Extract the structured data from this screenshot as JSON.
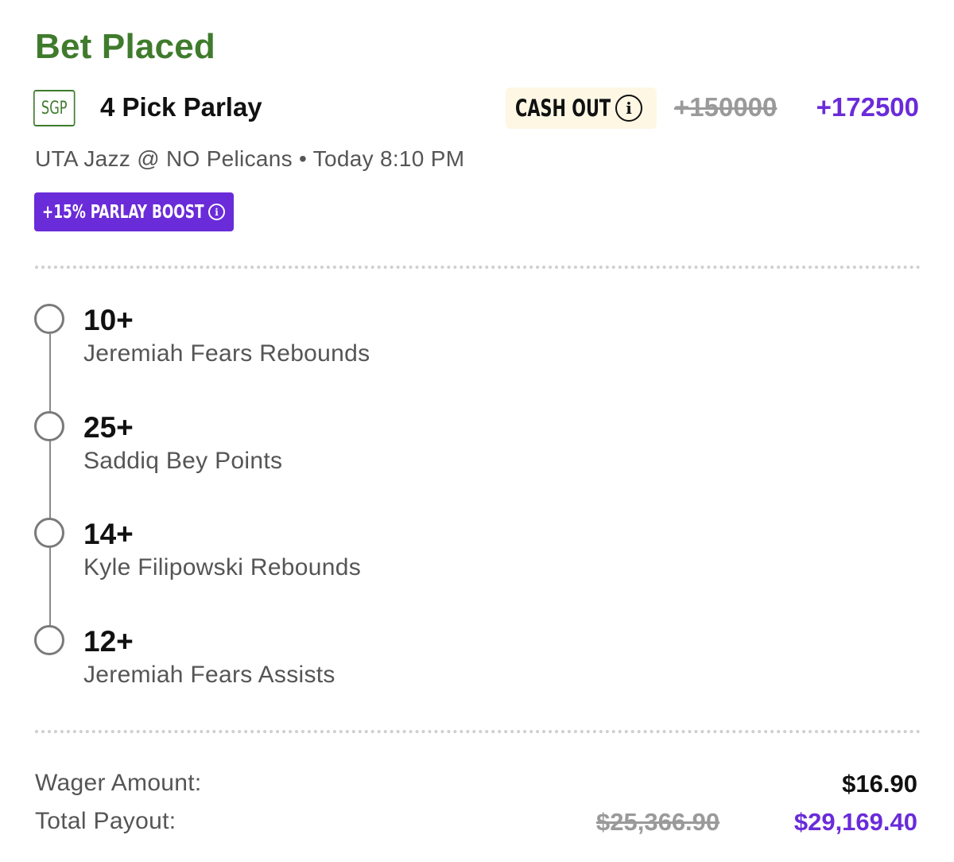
{
  "status": {
    "title": "Bet Placed"
  },
  "header": {
    "badge": "SGP",
    "title": "4 Pick Parlay",
    "cash_out_label": "CASH OUT",
    "info_glyph": "i",
    "original_odds": "+150000",
    "boosted_odds": "+172500"
  },
  "game": {
    "info": "UTA Jazz @ NO Pelicans • Today 8:10 PM"
  },
  "boost": {
    "label": "+15% PARLAY BOOST",
    "info_glyph": "i"
  },
  "legs": [
    {
      "line": "10+",
      "description": "Jeremiah Fears Rebounds"
    },
    {
      "line": "25+",
      "description": "Saddiq Bey Points"
    },
    {
      "line": "14+",
      "description": "Kyle Filipowski Rebounds"
    },
    {
      "line": "12+",
      "description": "Jeremiah Fears Assists"
    }
  ],
  "summary": {
    "wager_label": "Wager Amount:",
    "wager_value": "$16.90",
    "payout_label": "Total Payout:",
    "original_payout": "$25,366.90",
    "boosted_payout": "$29,169.40"
  },
  "colors": {
    "status_green": "#3f7b2c",
    "boost_purple": "#6a2bd9",
    "cash_out_bg": "#fdf7e4",
    "struck_gray": "#9a9a9a"
  },
  "icons": {
    "cash_out_info": "info-circle-icon",
    "boost_info": "info-circle-icon",
    "leg_marker": "empty-circle-icon"
  }
}
